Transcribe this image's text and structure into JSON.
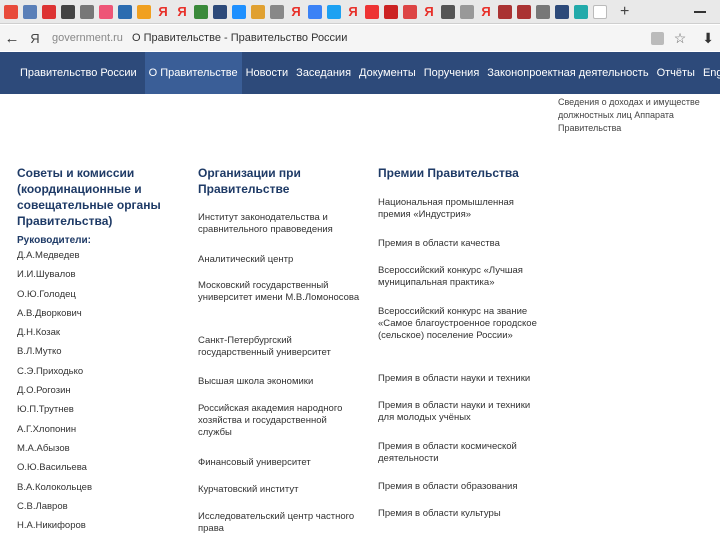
{
  "browser": {
    "tab_letter": "Я",
    "new_tab": "+",
    "back": "←",
    "yandex": "Я",
    "url_domain": "government.ru",
    "url_page": "О Правительстве - Правительство России",
    "star": "☆",
    "download": "⬇"
  },
  "nav": {
    "items": [
      "Правительство России",
      "О Правительстве",
      "Новости",
      "Заседания",
      "Документы",
      "Поручения",
      "Законопроектная деятельность",
      "Отчёты",
      "Eng"
    ]
  },
  "top_right_text": "Сведения о доходах и имуществе должностных лиц Аппарата Правительства",
  "col1": {
    "title": "Советы и комиссии (координационные и совещательные органы Правительства)",
    "subtitle": "Руководители:",
    "items": [
      "Д.А.Медведев",
      "И.И.Шувалов",
      "О.Ю.Голодец",
      "А.В.Дворкович",
      "Д.Н.Козак",
      "В.Л.Мутко",
      "С.Э.Приходько",
      "Д.О.Рогозин",
      "Ю.П.Трутнев",
      "А.Г.Хлопонин",
      "М.А.Абызов",
      "О.Ю.Васильева",
      "В.А.Колокольцев",
      "С.В.Лавров",
      "Н.А.Никифоров"
    ]
  },
  "col2": {
    "title": "Организации при Правительстве",
    "items": [
      "Институт законодательства и сравнительного правоведения",
      "Аналитический центр",
      "Московский государственный университет имени М.В.Ломоносова",
      "Санкт-Петербургский государственный университет",
      "Высшая школа экономики",
      "Российская академия народного хозяйства и государственной службы",
      "Финансовый университет",
      "Курчатовский институт",
      "Исследовательский центр частного права"
    ]
  },
  "col3": {
    "title": "Премии Правительства",
    "items": [
      "Национальная промышленная премия «Индустрия»",
      "Премия в области качества",
      "Всероссийский конкурс «Лучшая муниципальная практика»",
      "Всероссийский конкурс на звание «Самое благоустроенное городское (сельское) поселение России»",
      "Премия в области науки и техники",
      "Премия в области науки и техники для молодых учёных",
      "Премия в области космической деятельности",
      "Премия в области образования",
      "Премия в области культуры"
    ]
  },
  "colors": {
    "nav_bg": "#2d4a7a",
    "nav_selected": "#3a5e97",
    "heading": "#1e3a66"
  }
}
